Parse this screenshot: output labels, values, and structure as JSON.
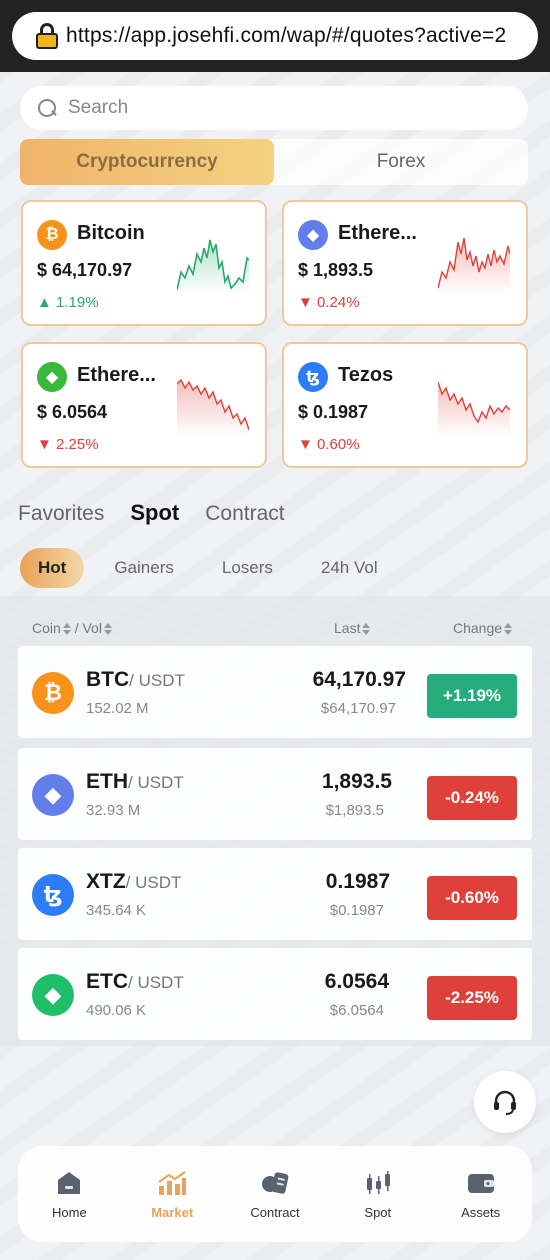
{
  "browser": {
    "url": "https://app.josehfi.com/wap/#/quotes?active=2"
  },
  "search": {
    "placeholder": "Search"
  },
  "category_tabs": [
    {
      "label": "Cryptocurrency",
      "active": true
    },
    {
      "label": "Forex",
      "active": false
    }
  ],
  "cards": [
    {
      "name": "Bitcoin",
      "price": "$ 64,170.97",
      "change": "1.19%",
      "direction": "up",
      "logo": "bitcoin-icon",
      "color": "#f7931a",
      "glyph": "₿"
    },
    {
      "name": "Ethere...",
      "price": "$ 1,893.5",
      "change": "0.24%",
      "direction": "down",
      "logo": "ethereum-icon",
      "color": "#627eea",
      "glyph": "◆"
    },
    {
      "name": "Ethere...",
      "price": "$ 6.0564",
      "change": "2.25%",
      "direction": "down",
      "logo": "ethereum-classic-icon",
      "color": "#3ab83a",
      "glyph": "◆"
    },
    {
      "name": "Tezos",
      "price": "$ 0.1987",
      "change": "0.60%",
      "direction": "down",
      "logo": "tezos-icon",
      "color": "#2c7df7",
      "glyph": "ꜩ"
    }
  ],
  "market_tabs": [
    {
      "label": "Favorites",
      "active": false
    },
    {
      "label": "Spot",
      "active": true
    },
    {
      "label": "Contract",
      "active": false
    }
  ],
  "sub_tabs": [
    {
      "label": "Hot",
      "active": true
    },
    {
      "label": "Gainers",
      "active": false
    },
    {
      "label": "Losers",
      "active": false
    },
    {
      "label": "24h Vol",
      "active": false
    }
  ],
  "list_header": {
    "coin": "Coin",
    "vol": "/ Vol",
    "last": "Last",
    "change": "Change"
  },
  "rows": [
    {
      "symbol": "BTC",
      "quote": "/ USDT",
      "volume": "152.02 M",
      "last": "64,170.97",
      "last_usd": "$64,170.97",
      "change": "+1.19%",
      "direction": "up",
      "logo": "bitcoin-icon",
      "color": "#f7931a",
      "glyph": "₿"
    },
    {
      "symbol": "ETH",
      "quote": "/ USDT",
      "volume": "32.93 M",
      "last": "1,893.5",
      "last_usd": "$1,893.5",
      "change": "-0.24%",
      "direction": "down",
      "logo": "ethereum-icon",
      "color": "#627eea",
      "glyph": "◆"
    },
    {
      "symbol": "XTZ",
      "quote": "/ USDT",
      "volume": "345.64 K",
      "last": "0.1987",
      "last_usd": "$0.1987",
      "change": "-0.60%",
      "direction": "down",
      "logo": "tezos-icon",
      "color": "#2c7df7",
      "glyph": "ꜩ"
    },
    {
      "symbol": "ETC",
      "quote": "/ USDT",
      "volume": "490.06 K",
      "last": "6.0564",
      "last_usd": "$6.0564",
      "change": "-2.25%",
      "direction": "down",
      "logo": "ethereum-classic-icon",
      "color": "#1fbf6a",
      "glyph": "◆"
    }
  ],
  "bottom_nav": [
    {
      "label": "Home",
      "icon": "home-icon",
      "active": false
    },
    {
      "label": "Market",
      "icon": "market-icon",
      "active": true
    },
    {
      "label": "Contract",
      "icon": "contract-icon",
      "active": false
    },
    {
      "label": "Spot",
      "icon": "spot-candlestick-icon",
      "active": false
    },
    {
      "label": "Assets",
      "icon": "wallet-icon",
      "active": false
    }
  ],
  "colors": {
    "up": "#25ad7d",
    "down": "#e0403a",
    "accent": "#e9a257"
  }
}
